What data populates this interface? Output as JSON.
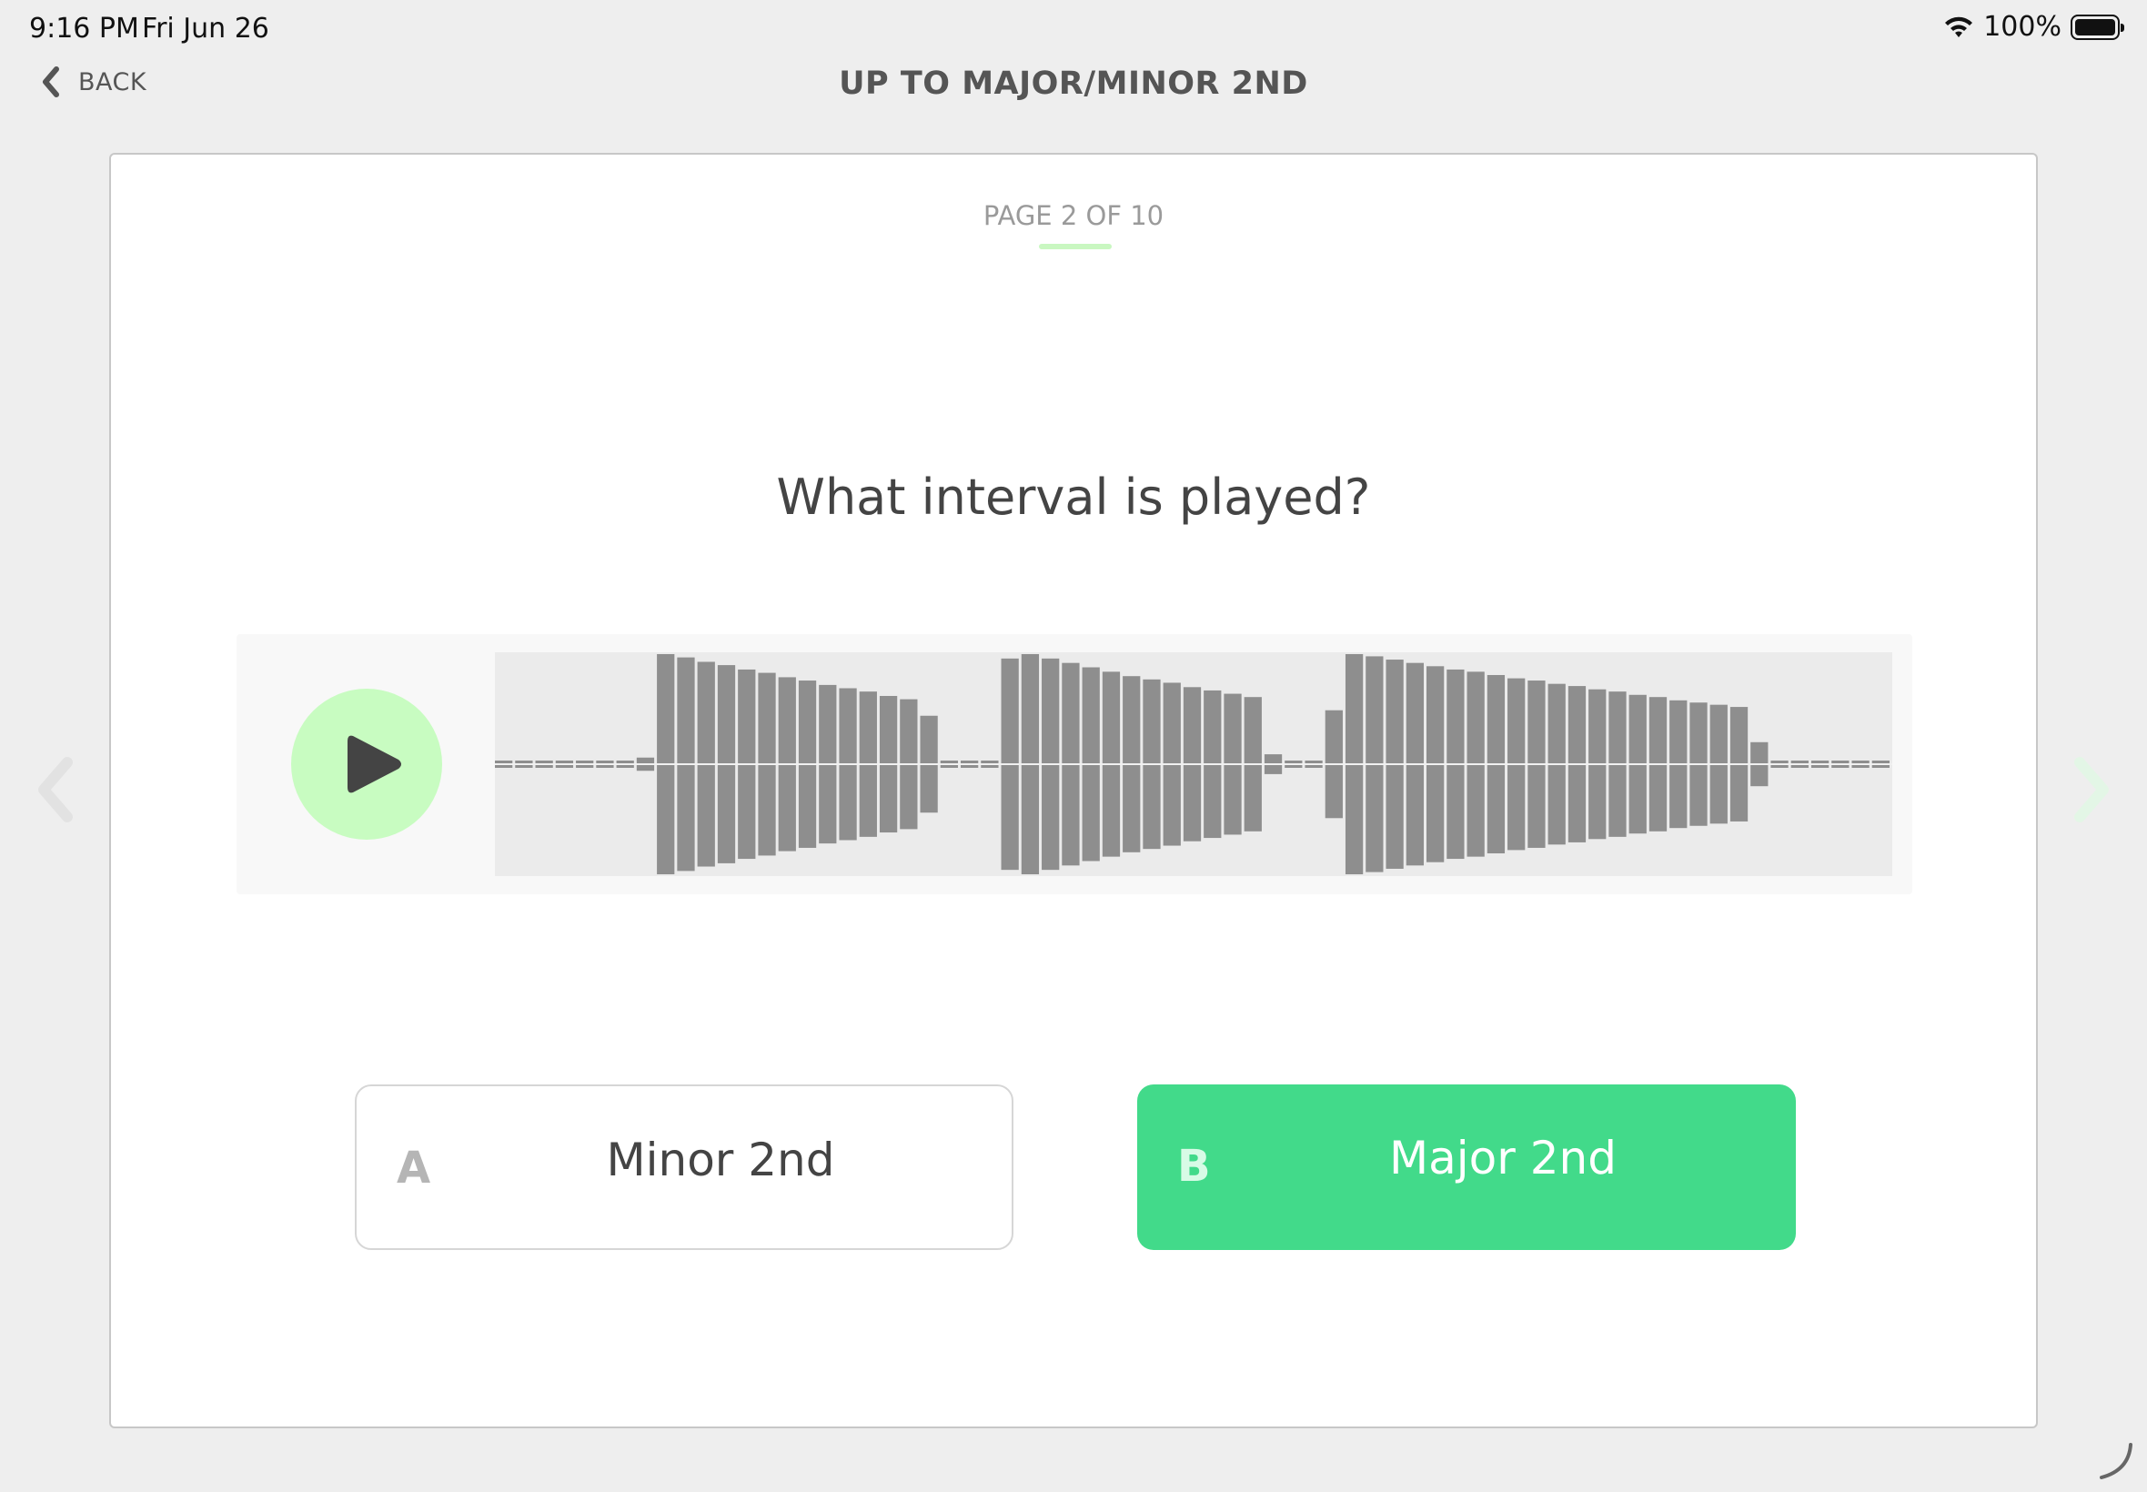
{
  "status_bar": {
    "time": "9:16 PM",
    "date": "Fri Jun 26",
    "battery": "100%"
  },
  "nav": {
    "back_label": "BACK",
    "title": "UP TO MAJOR/MINOR 2ND"
  },
  "lesson": {
    "page": "PAGE 2 OF 10",
    "question": "What interval is played?"
  },
  "player": {
    "play_icon": "play-icon",
    "waveform_levels": [
      0.03,
      0.03,
      0.03,
      0.03,
      0.03,
      0.03,
      0.03,
      0.06,
      1.0,
      0.97,
      0.93,
      0.9,
      0.86,
      0.83,
      0.79,
      0.76,
      0.72,
      0.69,
      0.66,
      0.62,
      0.59,
      0.44,
      0.03,
      0.03,
      0.03,
      0.96,
      1.0,
      0.96,
      0.92,
      0.88,
      0.84,
      0.8,
      0.77,
      0.74,
      0.7,
      0.67,
      0.64,
      0.61,
      0.09,
      0.03,
      0.03,
      0.49,
      1.0,
      0.98,
      0.95,
      0.92,
      0.89,
      0.86,
      0.84,
      0.81,
      0.78,
      0.76,
      0.73,
      0.71,
      0.68,
      0.66,
      0.63,
      0.61,
      0.58,
      0.56,
      0.54,
      0.52,
      0.2,
      0.03,
      0.03,
      0.03,
      0.03,
      0.03,
      0.03
    ]
  },
  "answers": [
    {
      "letter": "A",
      "text": "Minor 2nd",
      "selected": false
    },
    {
      "letter": "B",
      "text": "Major 2nd",
      "selected": true
    }
  ],
  "colors": {
    "accent_green": "#42da8a",
    "play_button": "#c8fcc1",
    "waveform_bar": "#8e8e8e"
  }
}
